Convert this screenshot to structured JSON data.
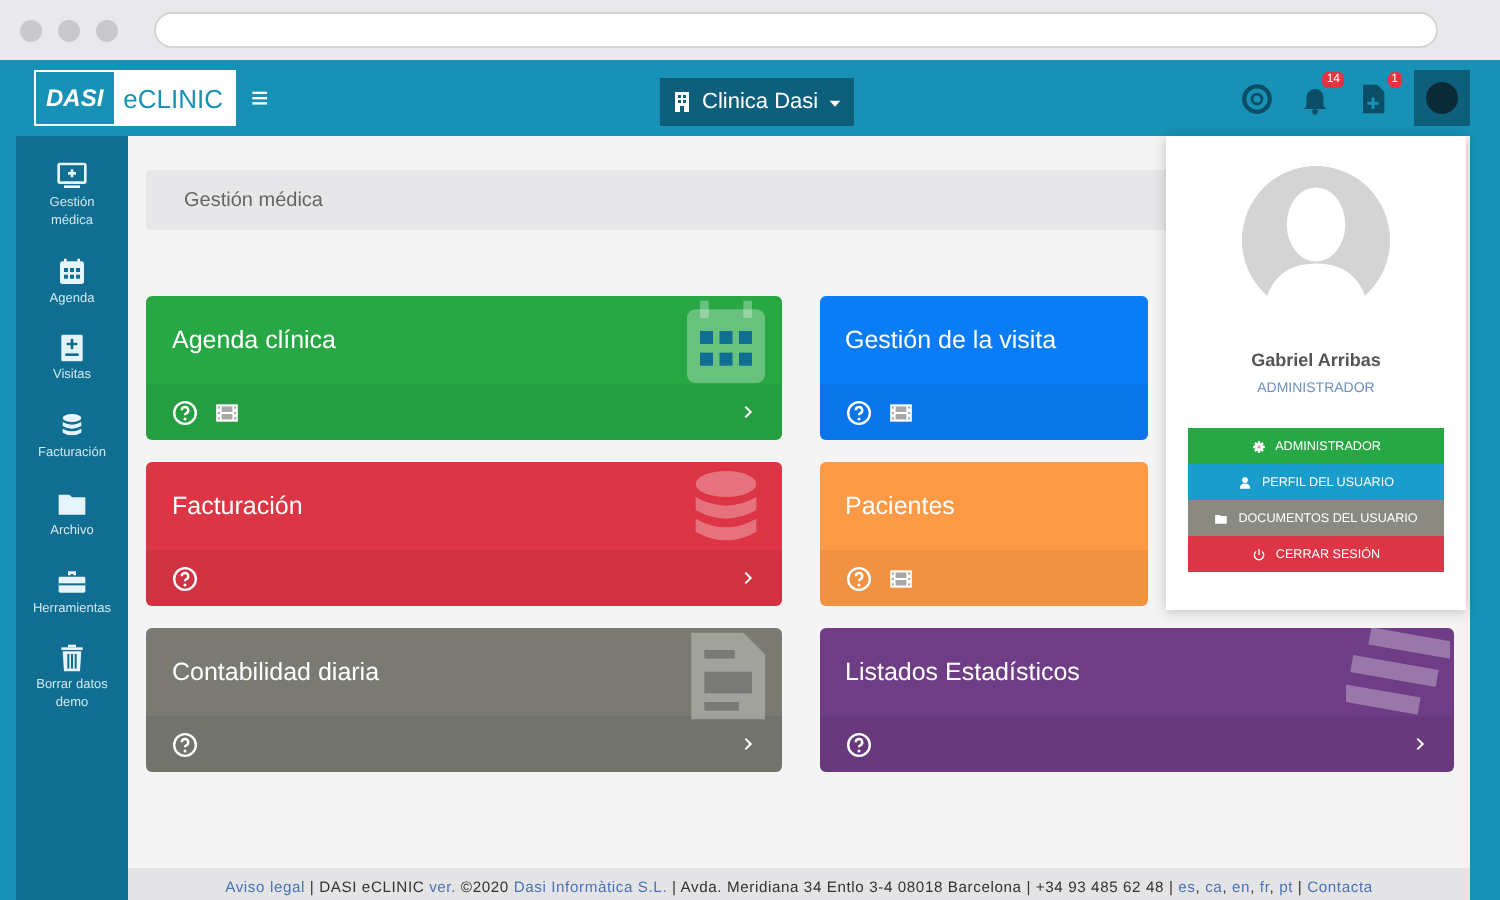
{
  "topbar": {
    "logo_mark": "DASI",
    "logo_text": "eCLINIC",
    "menu_glyph": "≡",
    "clinic": "Clinica Dasi",
    "notifications_badge": "14",
    "documents_badge": "1"
  },
  "sidebar": {
    "items": [
      {
        "label": "Gestión médica"
      },
      {
        "label": "Agenda"
      },
      {
        "label": "Visitas"
      },
      {
        "label": "Facturación"
      },
      {
        "label": "Archivo"
      },
      {
        "label": "Herramientas"
      },
      {
        "label": "Borrar datos demo"
      }
    ]
  },
  "breadcrumb": "Gestión médica",
  "cards": [
    {
      "title": "Agenda clínica",
      "color": "#28a745",
      "video": true,
      "arrow": true
    },
    {
      "title": "Gestión de la visita",
      "color": "#0a7cf5",
      "video": true,
      "arrow": false
    },
    {
      "title": "Facturación",
      "color": "#dc3545",
      "video": false,
      "arrow": true
    },
    {
      "title": "Pacientes",
      "color": "#fd9a45",
      "video": true,
      "arrow": false
    },
    {
      "title": "Contabilidad diaria",
      "color": "#7a7a73",
      "video": false,
      "arrow": true
    },
    {
      "title": "Listados Estadísticos",
      "color": "#6f3d85",
      "video": false,
      "arrow": true
    }
  ],
  "user_menu": {
    "name": "Gabriel Arribas",
    "role": "ADMINISTRADOR",
    "items": [
      {
        "label": "ADMINISTRADOR",
        "color": "#28a745"
      },
      {
        "label": "PERFIL DEL USUARIO",
        "color": "#1a9ccc"
      },
      {
        "label": "DOCUMENTOS DEL USUARIO",
        "color": "#8a8a80"
      },
      {
        "label": "CERRAR SESIÓN",
        "color": "#dc3545"
      }
    ]
  },
  "footer": [
    {
      "text": "Aviso legal",
      "link": true
    },
    {
      "text": " | DASI eCLINIC ",
      "link": false
    },
    {
      "text": "ver.",
      "link": true
    },
    {
      "text": " ©2020 ",
      "link": false
    },
    {
      "text": "Dasi Informàtica S.L.",
      "link": true
    },
    {
      "text": " | Avda. Meridiana 34 Entlo 3-4 08018 Barcelona | +34 93 485 62 48 | ",
      "link": false
    },
    {
      "text": "es",
      "link": true
    },
    {
      "text": ", ",
      "link": false
    },
    {
      "text": "ca",
      "link": true
    },
    {
      "text": ", ",
      "link": false
    },
    {
      "text": "en",
      "link": true
    },
    {
      "text": ", ",
      "link": false
    },
    {
      "text": "fr",
      "link": true
    },
    {
      "text": ", ",
      "link": false
    },
    {
      "text": "pt",
      "link": true
    },
    {
      "text": " | ",
      "link": false
    },
    {
      "text": "Contacta",
      "link": true
    }
  ]
}
